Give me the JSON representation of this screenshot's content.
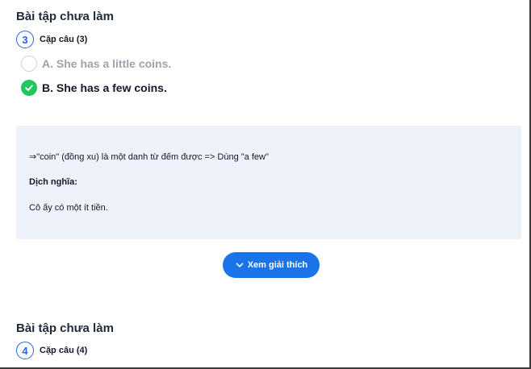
{
  "section1": {
    "title": "Bài tập chưa làm",
    "question_number": "3",
    "question_label": "Cặp câu (3)",
    "options": [
      {
        "text": "A. She has a little coins.",
        "state": "unselected"
      },
      {
        "text": "B. She has a few coins.",
        "state": "correct"
      }
    ]
  },
  "explanation": {
    "line1": "⇒\"coin\" (đồng xu) là một danh từ đếm được => Dùng \"a few\"",
    "translation_heading": "Dịch nghĩa:",
    "translation": "Cô ấy có một ít tiền."
  },
  "button": {
    "label": "Xem giải thích",
    "icon": "chevron-down-icon"
  },
  "section2": {
    "title": "Bài tập chưa làm",
    "question_number": "4",
    "question_label": "Cặp câu (4)"
  },
  "colors": {
    "accent": "#1a73e8",
    "correct": "#22c55e",
    "explanation_bg": "#eef2fb",
    "muted_text": "#9ca3af"
  }
}
